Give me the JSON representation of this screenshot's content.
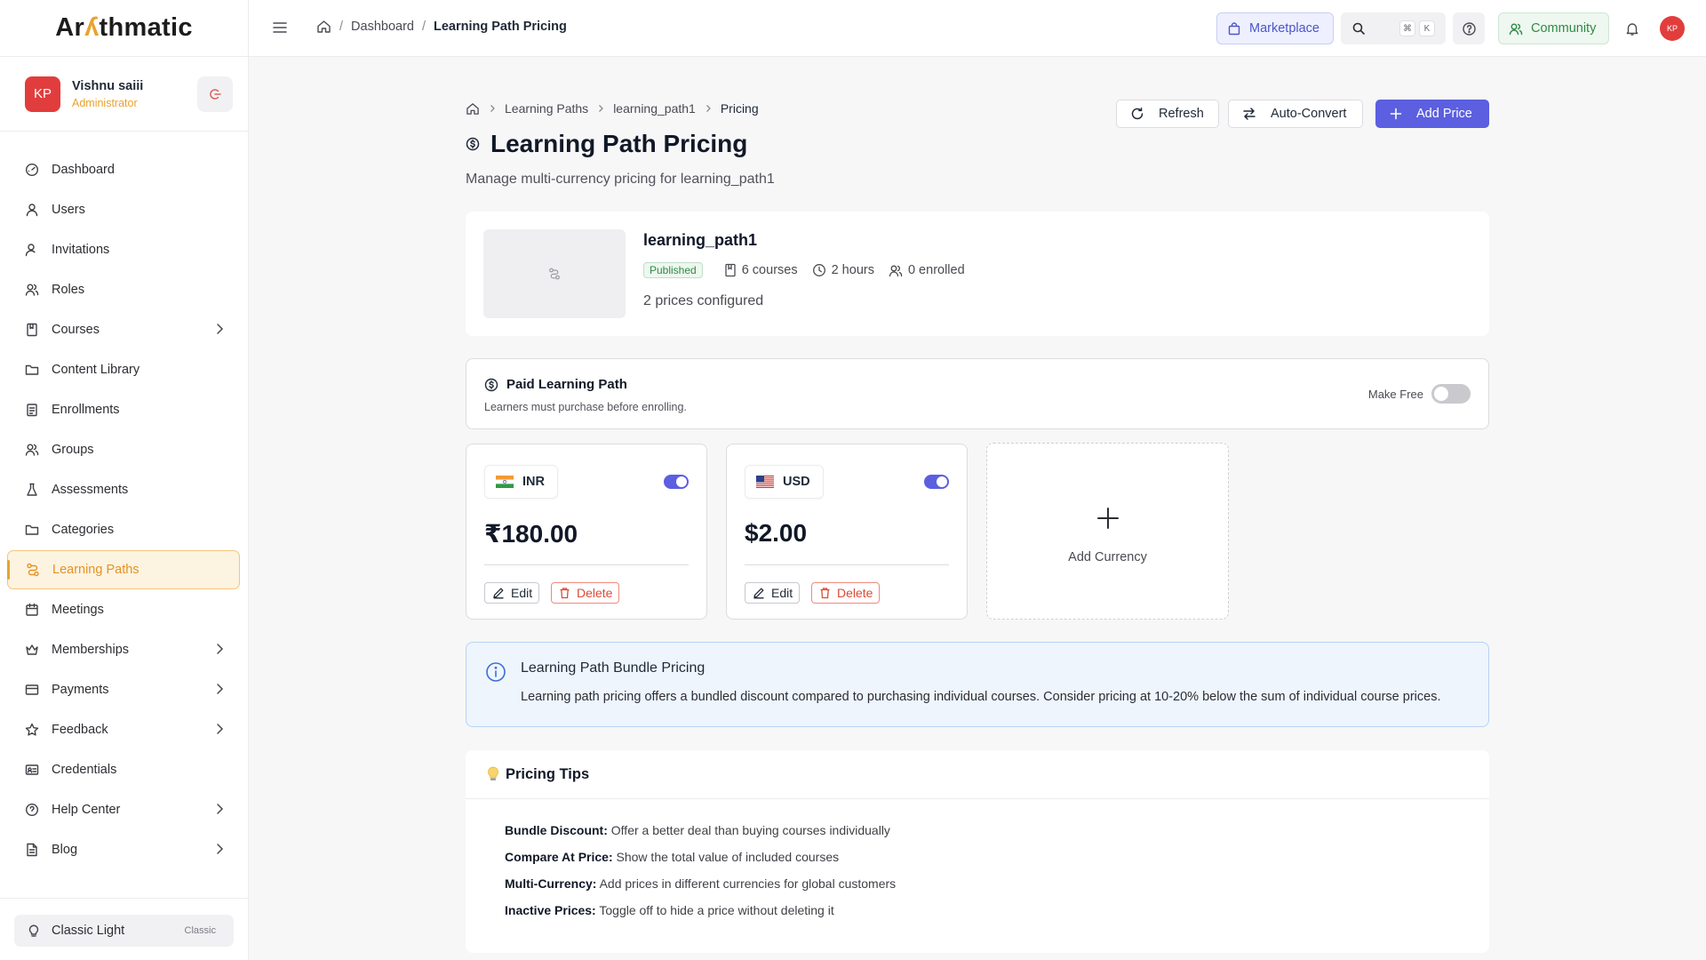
{
  "app": {
    "logo_prefix": "Ar",
    "logo_accent": "ʎ",
    "logo_suffix": "thmatic"
  },
  "user": {
    "name": "Vishnu saiii",
    "role": "Administrator",
    "initials": "KP"
  },
  "sidebar": {
    "items": [
      {
        "label": "Dashboard",
        "icon": "gauge-icon"
      },
      {
        "label": "Users",
        "icon": "user-icon"
      },
      {
        "label": "Invitations",
        "icon": "user-plus-icon"
      },
      {
        "label": "Roles",
        "icon": "roles-icon"
      },
      {
        "label": "Courses",
        "icon": "book-icon",
        "chevron": true
      },
      {
        "label": "Content Library",
        "icon": "folder-icon"
      },
      {
        "label": "Enrollments",
        "icon": "clipboard-icon"
      },
      {
        "label": "Groups",
        "icon": "groups-icon"
      },
      {
        "label": "Assessments",
        "icon": "flask-icon"
      },
      {
        "label": "Categories",
        "icon": "folder-icon"
      },
      {
        "label": "Learning Paths",
        "icon": "route-icon",
        "active": true
      },
      {
        "label": "Meetings",
        "icon": "calendar-icon"
      },
      {
        "label": "Memberships",
        "icon": "crown-icon",
        "chevron": true
      },
      {
        "label": "Payments",
        "icon": "credit-card-icon",
        "chevron": true
      },
      {
        "label": "Feedback",
        "icon": "star-icon",
        "chevron": true
      },
      {
        "label": "Credentials",
        "icon": "id-card-icon"
      },
      {
        "label": "Help Center",
        "icon": "help-circle-icon",
        "chevron": true
      },
      {
        "label": "Blog",
        "icon": "document-icon",
        "chevron": true
      }
    ]
  },
  "theme": {
    "label": "Classic Light",
    "tag": "Classic"
  },
  "topbar": {
    "crumbs": [
      "Dashboard",
      "Learning Path Pricing"
    ],
    "marketplace": "Marketplace",
    "kbd": [
      "⌘",
      "K"
    ],
    "community": "Community",
    "avatar": "KP"
  },
  "page": {
    "crumbs": [
      "Learning Paths",
      "learning_path1",
      "Pricing"
    ],
    "title": "Learning Path Pricing",
    "subtitle": "Manage multi-currency pricing for learning_path1",
    "actions": {
      "refresh": "Refresh",
      "auto_convert": "Auto-Convert",
      "add_price": "Add Price"
    }
  },
  "path": {
    "name": "learning_path1",
    "status": "Published",
    "courses": "6 courses",
    "duration": "2 hours",
    "enrolled": "0 enrolled",
    "prices_configured": "2 prices configured"
  },
  "paid": {
    "title": "Paid Learning Path",
    "description": "Learners must purchase before enrolling.",
    "make_free_label": "Make Free",
    "make_free_on": false
  },
  "prices": [
    {
      "currency": "INR",
      "amount": "₹180.00",
      "active": true,
      "edit": "Edit",
      "delete": "Delete"
    },
    {
      "currency": "USD",
      "amount": "$2.00",
      "active": true,
      "edit": "Edit",
      "delete": "Delete"
    }
  ],
  "add_currency": "Add Currency",
  "bundle": {
    "title": "Learning Path Bundle Pricing",
    "text": "Learning path pricing offers a bundled discount compared to purchasing individual courses. Consider pricing at 10-20% below the sum of individual course prices."
  },
  "tips": {
    "title": "Pricing Tips",
    "items": [
      {
        "label": "Bundle Discount:",
        "text": "Offer a better deal than buying courses individually"
      },
      {
        "label": "Compare At Price:",
        "text": "Show the total value of included courses"
      },
      {
        "label": "Multi-Currency:",
        "text": "Add prices in different currencies for global customers"
      },
      {
        "label": "Inactive Prices:",
        "text": "Toggle off to hide a price without deleting it"
      }
    ]
  },
  "colors": {
    "accent": "#e8a32e",
    "primary": "#5b5fe0",
    "danger": "#dc4a35",
    "success": "#2f8a45"
  }
}
